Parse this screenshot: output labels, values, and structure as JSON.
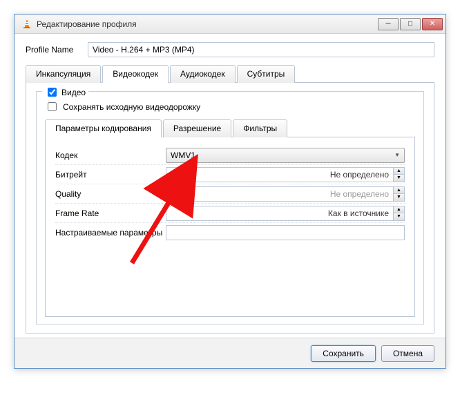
{
  "window": {
    "title": "Редактирование профиля"
  },
  "profile": {
    "label": "Profile Name",
    "value": "Video - H.264 + MP3 (MP4)"
  },
  "tabs": {
    "encapsulation": "Инкапсуляция",
    "videocodec": "Видеокодек",
    "audiocodec": "Аудиокодек",
    "subtitles": "Субтитры"
  },
  "video_section": {
    "video_checkbox": "Видео",
    "keep_original": "Сохранять исходную видеодорожку"
  },
  "subtabs": {
    "encoding_params": "Параметры кодирования",
    "resolution": "Разрешение",
    "filters": "Фильтры"
  },
  "form": {
    "codec_label": "Кодек",
    "codec_value": "WMV1",
    "bitrate_label": "Битрейт",
    "bitrate_value": "Не определено",
    "quality_label": "Quality",
    "quality_value": "Не определено",
    "framerate_label": "Frame Rate",
    "framerate_value": "Как в источнике",
    "custom_params_label": "Настраиваемые параметры"
  },
  "footer": {
    "save": "Сохранить",
    "cancel": "Отмена"
  }
}
